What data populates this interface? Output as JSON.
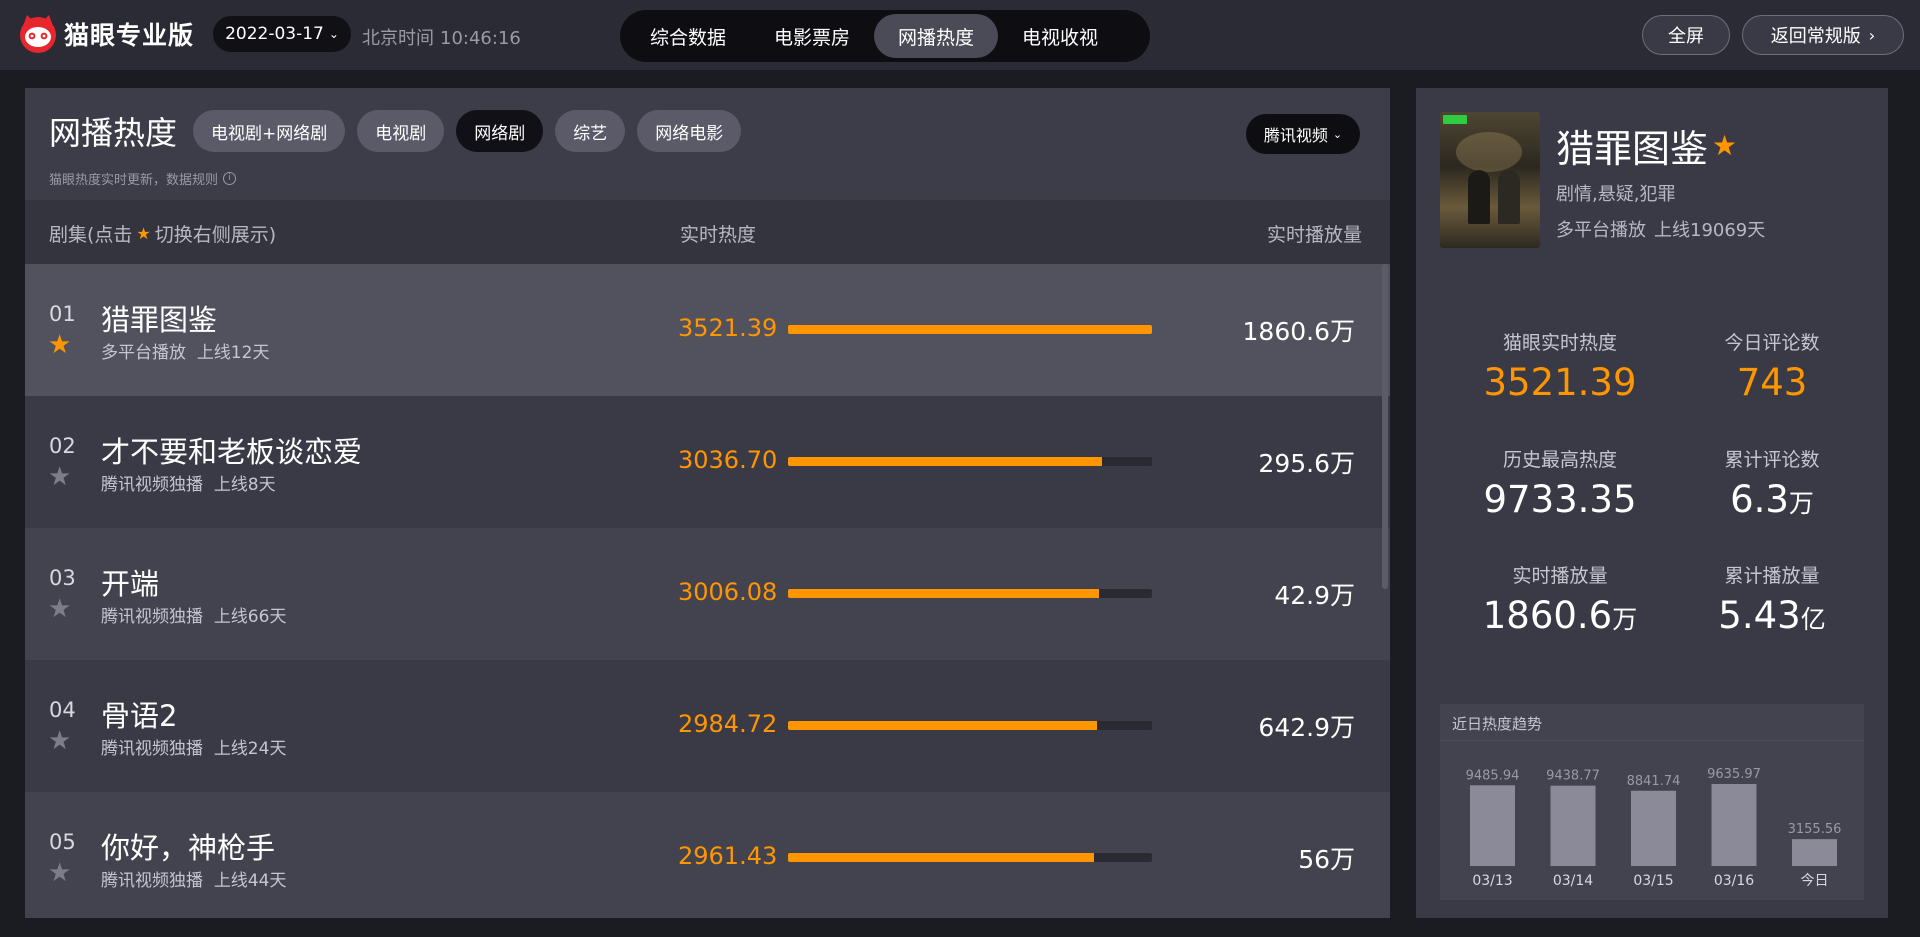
{
  "header": {
    "brand": "猫眼专业版",
    "date": "2022-03-17",
    "clock_label": "北京时间",
    "clock_time": "10:46:16",
    "nav_tabs": [
      "综合数据",
      "电影票房",
      "网播热度",
      "电视收视"
    ],
    "active_tab": "网播热度",
    "fullscreen": "全屏",
    "back": "返回常规版"
  },
  "main": {
    "title": "网播热度",
    "categories": [
      "电视剧+网络剧",
      "电视剧",
      "网络剧",
      "综艺",
      "网络电影"
    ],
    "active_category": "网络剧",
    "note": "猫眼热度实时更新，数据规则",
    "platform": "腾讯视频",
    "columns": {
      "col1_prefix": "剧集(点击",
      "col1_suffix": "切换右侧展示)",
      "col2": "实时热度",
      "col3": "实时播放量"
    },
    "rows": [
      {
        "rank": "01",
        "title": "猎罪图鉴",
        "platform": "多平台播放",
        "online": "上线12天",
        "heat": "3521.39",
        "heat_value": 3521.39,
        "plays": "1860.6万",
        "starred": true
      },
      {
        "rank": "02",
        "title": "才不要和老板谈恋爱",
        "platform": "腾讯视频独播",
        "online": "上线8天",
        "heat": "3036.70",
        "heat_value": 3036.7,
        "plays": "295.6万",
        "starred": false
      },
      {
        "rank": "03",
        "title": "开端",
        "platform": "腾讯视频独播",
        "online": "上线66天",
        "heat": "3006.08",
        "heat_value": 3006.08,
        "plays": "42.9万",
        "starred": false
      },
      {
        "rank": "04",
        "title": "骨语2",
        "platform": "腾讯视频独播",
        "online": "上线24天",
        "heat": "2984.72",
        "heat_value": 2984.72,
        "plays": "642.9万",
        "starred": false
      },
      {
        "rank": "05",
        "title": "你好，神枪手",
        "platform": "腾讯视频独播",
        "online": "上线44天",
        "heat": "2961.43",
        "heat_value": 2961.43,
        "plays": "56万",
        "starred": false
      }
    ]
  },
  "detail": {
    "title": "猎罪图鉴",
    "genre": "剧情,悬疑,犯罪",
    "platform": "多平台播放",
    "online": "上线19069天",
    "stats": {
      "realtime_heat_label": "猫眼实时热度",
      "realtime_heat": "3521.39",
      "today_comments_label": "今日评论数",
      "today_comments": "743",
      "max_heat_label": "历史最高热度",
      "max_heat": "9733.35",
      "total_comments_label": "累计评论数",
      "total_comments": "6.3",
      "total_comments_unit": "万",
      "realtime_plays_label": "实时播放量",
      "realtime_plays": "1860.6",
      "realtime_plays_unit": "万",
      "total_plays_label": "累计播放量",
      "total_plays": "5.43",
      "total_plays_unit": "亿"
    },
    "trend_title": "近日热度趋势"
  },
  "colors": {
    "accent": "#ff9600",
    "trend_bar": "#8a8a98"
  },
  "chart_data": {
    "type": "bar",
    "categories": [
      "03/13",
      "03/14",
      "03/15",
      "03/16",
      "今日"
    ],
    "values": [
      9485.94,
      9438.77,
      8841.74,
      9635.97,
      3155.56
    ],
    "value_labels": [
      "9485.94",
      "9438.77",
      "8841.74",
      "9635.97",
      "3155.56"
    ],
    "title": "近日热度趋势",
    "ylim": [
      0,
      9635.97
    ]
  }
}
